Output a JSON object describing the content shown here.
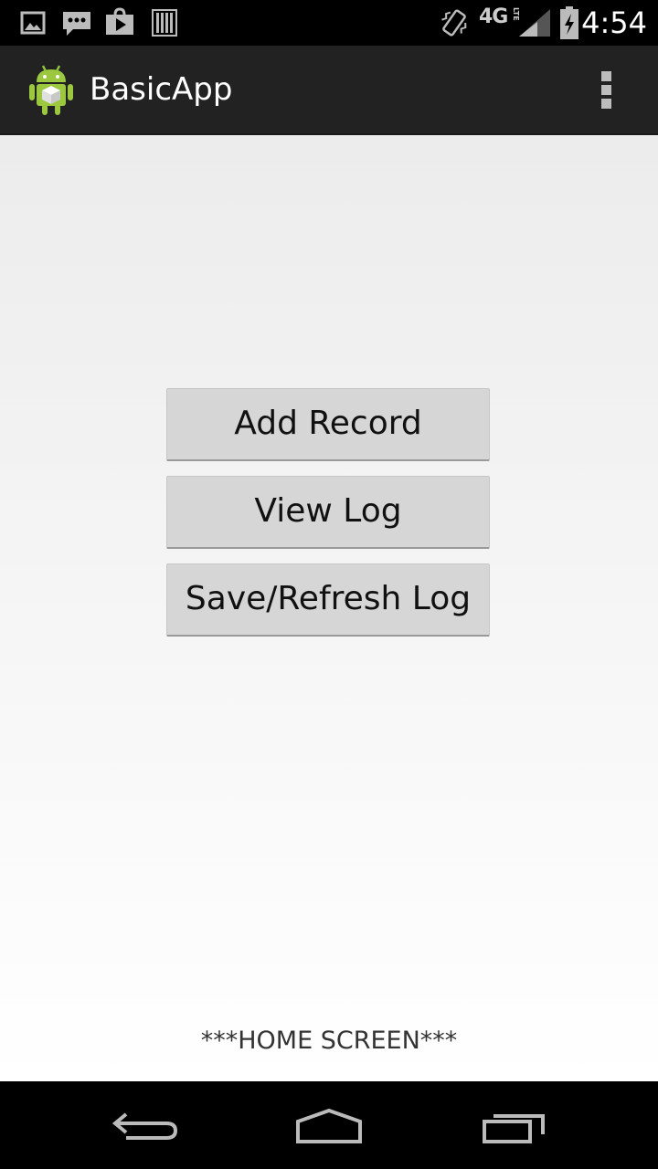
{
  "status_bar": {
    "time": "4:54",
    "network_label": "4G",
    "icons": [
      "gallery-icon",
      "message-icon",
      "play-store-icon",
      "barcode-icon",
      "vibrate-icon",
      "network-4g-lte-icon",
      "signal-icon",
      "battery-charging-icon"
    ]
  },
  "action_bar": {
    "title": "BasicApp",
    "icon": "android-app-icon",
    "overflow_icon": "overflow-menu-icon"
  },
  "main": {
    "buttons": [
      {
        "label": "Add Record"
      },
      {
        "label": "View Log"
      },
      {
        "label": "Save/Refresh Log"
      }
    ],
    "footer_label": "***HOME SCREEN***"
  },
  "nav_bar": {
    "icons": [
      "back-icon",
      "home-icon",
      "recents-icon"
    ]
  },
  "colors": {
    "action_bar_bg": "#222222",
    "button_bg": "#d6d6d6",
    "content_bg_top": "#ececec",
    "content_bg_bottom": "#ffffff"
  }
}
